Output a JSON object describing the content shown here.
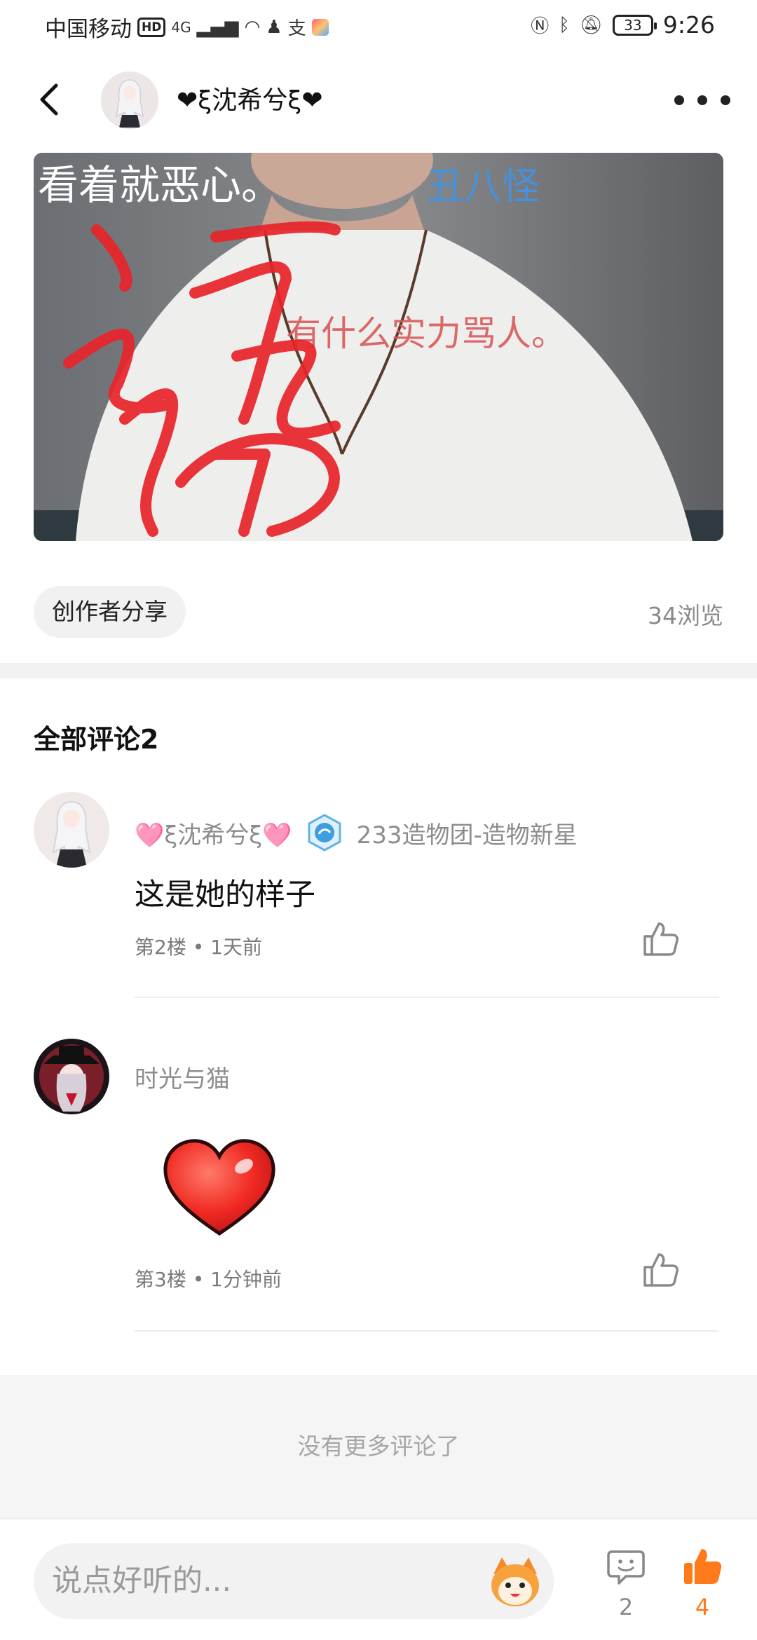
{
  "status_bar": {
    "carrier": "中国移动",
    "hd": "HD",
    "network": "4G",
    "battery": "33",
    "time": "9:26"
  },
  "header": {
    "author_name": "❤ξ沈希兮ξ❤",
    "back_icon": "chevron-left-icon",
    "more_icon": "more-dots-icon"
  },
  "post": {
    "image_texts": {
      "left_caption": "看着就恶心。",
      "right_caption": "丑八怪",
      "middle_caption": "有什么实力骂人。"
    },
    "tag_label": "创作者分享",
    "views_text": "34浏览"
  },
  "comments_section": {
    "title": "全部评论2",
    "items": [
      {
        "username": "🩷ξ沈希兮ξ🩷",
        "badge_text": "233造物团-造物新星",
        "text": "这是她的样子",
        "meta": "第2楼 • 1天前"
      },
      {
        "username": "时光与猫",
        "sticker": "red-heart-sticker",
        "meta": "第3楼 • 1分钟前"
      }
    ],
    "end_text": "没有更多评论了"
  },
  "bottom_bar": {
    "input_placeholder": "说点好听的...",
    "comment_count": "2",
    "like_count": "4",
    "colors": {
      "like_active": "#ff7a1a",
      "icon_gray": "#888888"
    }
  }
}
